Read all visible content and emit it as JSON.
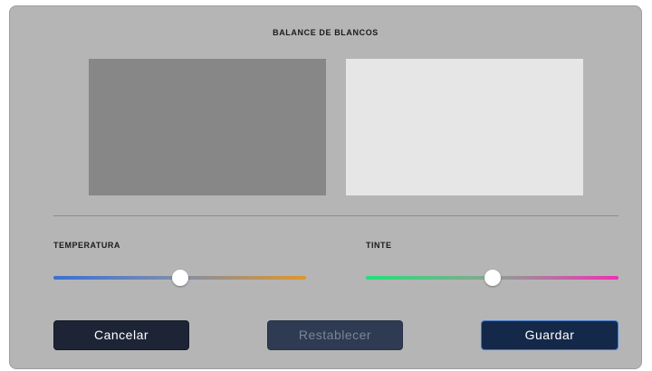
{
  "dialog": {
    "title": "BALANCE DE BLANCOS"
  },
  "preview": {
    "before_color": "#878787",
    "after_color": "#e6e6e6"
  },
  "sliders": {
    "temperature": {
      "label": "TEMPERATURA",
      "level_percent": 50,
      "gradient": [
        "#3b6fd6",
        "#e0962a"
      ]
    },
    "tint": {
      "label": "TINTE",
      "level_percent": 50,
      "gradient": [
        "#22e07a",
        "#f02fb6"
      ]
    }
  },
  "buttons": {
    "cancel_label": "Cancelar",
    "reset_label": "Restablecer",
    "save_label": "Guardar"
  },
  "colors": {
    "panel_bg": "#b5b5b5",
    "button_bg": "#1d2436",
    "save_border": "#3a7bd5",
    "disabled_text": "#7b8597"
  }
}
